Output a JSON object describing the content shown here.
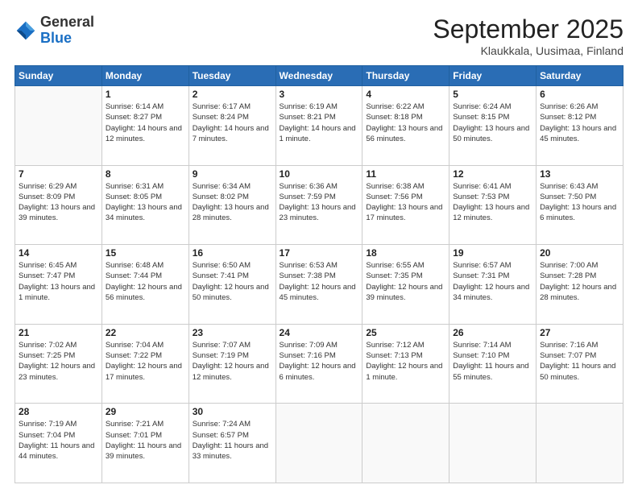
{
  "logo": {
    "general": "General",
    "blue": "Blue"
  },
  "header": {
    "month_title": "September 2025",
    "subtitle": "Klaukkala, Uusimaa, Finland"
  },
  "weekdays": [
    "Sunday",
    "Monday",
    "Tuesday",
    "Wednesday",
    "Thursday",
    "Friday",
    "Saturday"
  ],
  "weeks": [
    [
      {
        "day": "",
        "sunrise": "",
        "sunset": "",
        "daylight": ""
      },
      {
        "day": "1",
        "sunrise": "Sunrise: 6:14 AM",
        "sunset": "Sunset: 8:27 PM",
        "daylight": "Daylight: 14 hours and 12 minutes."
      },
      {
        "day": "2",
        "sunrise": "Sunrise: 6:17 AM",
        "sunset": "Sunset: 8:24 PM",
        "daylight": "Daylight: 14 hours and 7 minutes."
      },
      {
        "day": "3",
        "sunrise": "Sunrise: 6:19 AM",
        "sunset": "Sunset: 8:21 PM",
        "daylight": "Daylight: 14 hours and 1 minute."
      },
      {
        "day": "4",
        "sunrise": "Sunrise: 6:22 AM",
        "sunset": "Sunset: 8:18 PM",
        "daylight": "Daylight: 13 hours and 56 minutes."
      },
      {
        "day": "5",
        "sunrise": "Sunrise: 6:24 AM",
        "sunset": "Sunset: 8:15 PM",
        "daylight": "Daylight: 13 hours and 50 minutes."
      },
      {
        "day": "6",
        "sunrise": "Sunrise: 6:26 AM",
        "sunset": "Sunset: 8:12 PM",
        "daylight": "Daylight: 13 hours and 45 minutes."
      }
    ],
    [
      {
        "day": "7",
        "sunrise": "Sunrise: 6:29 AM",
        "sunset": "Sunset: 8:09 PM",
        "daylight": "Daylight: 13 hours and 39 minutes."
      },
      {
        "day": "8",
        "sunrise": "Sunrise: 6:31 AM",
        "sunset": "Sunset: 8:05 PM",
        "daylight": "Daylight: 13 hours and 34 minutes."
      },
      {
        "day": "9",
        "sunrise": "Sunrise: 6:34 AM",
        "sunset": "Sunset: 8:02 PM",
        "daylight": "Daylight: 13 hours and 28 minutes."
      },
      {
        "day": "10",
        "sunrise": "Sunrise: 6:36 AM",
        "sunset": "Sunset: 7:59 PM",
        "daylight": "Daylight: 13 hours and 23 minutes."
      },
      {
        "day": "11",
        "sunrise": "Sunrise: 6:38 AM",
        "sunset": "Sunset: 7:56 PM",
        "daylight": "Daylight: 13 hours and 17 minutes."
      },
      {
        "day": "12",
        "sunrise": "Sunrise: 6:41 AM",
        "sunset": "Sunset: 7:53 PM",
        "daylight": "Daylight: 13 hours and 12 minutes."
      },
      {
        "day": "13",
        "sunrise": "Sunrise: 6:43 AM",
        "sunset": "Sunset: 7:50 PM",
        "daylight": "Daylight: 13 hours and 6 minutes."
      }
    ],
    [
      {
        "day": "14",
        "sunrise": "Sunrise: 6:45 AM",
        "sunset": "Sunset: 7:47 PM",
        "daylight": "Daylight: 13 hours and 1 minute."
      },
      {
        "day": "15",
        "sunrise": "Sunrise: 6:48 AM",
        "sunset": "Sunset: 7:44 PM",
        "daylight": "Daylight: 12 hours and 56 minutes."
      },
      {
        "day": "16",
        "sunrise": "Sunrise: 6:50 AM",
        "sunset": "Sunset: 7:41 PM",
        "daylight": "Daylight: 12 hours and 50 minutes."
      },
      {
        "day": "17",
        "sunrise": "Sunrise: 6:53 AM",
        "sunset": "Sunset: 7:38 PM",
        "daylight": "Daylight: 12 hours and 45 minutes."
      },
      {
        "day": "18",
        "sunrise": "Sunrise: 6:55 AM",
        "sunset": "Sunset: 7:35 PM",
        "daylight": "Daylight: 12 hours and 39 minutes."
      },
      {
        "day": "19",
        "sunrise": "Sunrise: 6:57 AM",
        "sunset": "Sunset: 7:31 PM",
        "daylight": "Daylight: 12 hours and 34 minutes."
      },
      {
        "day": "20",
        "sunrise": "Sunrise: 7:00 AM",
        "sunset": "Sunset: 7:28 PM",
        "daylight": "Daylight: 12 hours and 28 minutes."
      }
    ],
    [
      {
        "day": "21",
        "sunrise": "Sunrise: 7:02 AM",
        "sunset": "Sunset: 7:25 PM",
        "daylight": "Daylight: 12 hours and 23 minutes."
      },
      {
        "day": "22",
        "sunrise": "Sunrise: 7:04 AM",
        "sunset": "Sunset: 7:22 PM",
        "daylight": "Daylight: 12 hours and 17 minutes."
      },
      {
        "day": "23",
        "sunrise": "Sunrise: 7:07 AM",
        "sunset": "Sunset: 7:19 PM",
        "daylight": "Daylight: 12 hours and 12 minutes."
      },
      {
        "day": "24",
        "sunrise": "Sunrise: 7:09 AM",
        "sunset": "Sunset: 7:16 PM",
        "daylight": "Daylight: 12 hours and 6 minutes."
      },
      {
        "day": "25",
        "sunrise": "Sunrise: 7:12 AM",
        "sunset": "Sunset: 7:13 PM",
        "daylight": "Daylight: 12 hours and 1 minute."
      },
      {
        "day": "26",
        "sunrise": "Sunrise: 7:14 AM",
        "sunset": "Sunset: 7:10 PM",
        "daylight": "Daylight: 11 hours and 55 minutes."
      },
      {
        "day": "27",
        "sunrise": "Sunrise: 7:16 AM",
        "sunset": "Sunset: 7:07 PM",
        "daylight": "Daylight: 11 hours and 50 minutes."
      }
    ],
    [
      {
        "day": "28",
        "sunrise": "Sunrise: 7:19 AM",
        "sunset": "Sunset: 7:04 PM",
        "daylight": "Daylight: 11 hours and 44 minutes."
      },
      {
        "day": "29",
        "sunrise": "Sunrise: 7:21 AM",
        "sunset": "Sunset: 7:01 PM",
        "daylight": "Daylight: 11 hours and 39 minutes."
      },
      {
        "day": "30",
        "sunrise": "Sunrise: 7:24 AM",
        "sunset": "Sunset: 6:57 PM",
        "daylight": "Daylight: 11 hours and 33 minutes."
      },
      {
        "day": "",
        "sunrise": "",
        "sunset": "",
        "daylight": ""
      },
      {
        "day": "",
        "sunrise": "",
        "sunset": "",
        "daylight": ""
      },
      {
        "day": "",
        "sunrise": "",
        "sunset": "",
        "daylight": ""
      },
      {
        "day": "",
        "sunrise": "",
        "sunset": "",
        "daylight": ""
      }
    ]
  ]
}
